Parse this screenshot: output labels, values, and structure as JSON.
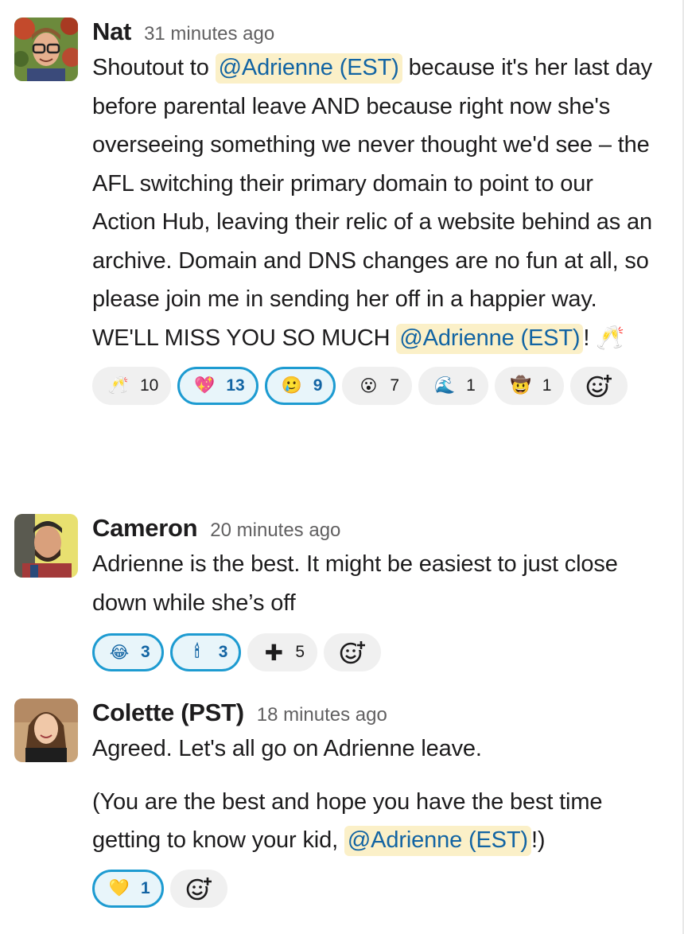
{
  "messages": [
    {
      "name": "Nat",
      "time": "31 minutes ago",
      "text_before_mention": "Shoutout to ",
      "mention_1": "@Adrienne (EST)",
      "text_after_mention": " because it's her last day before parental leave AND because right now she's overseeing something we never thought we'd see – the AFL switching their primary domain to point to our Action Hub, leaving their relic of a website behind as an archive. Domain and DNS changes are no fun at all, so please join me in sending her off in a happier way. WE'LL MISS YOU SO MUCH ",
      "mention_2": "@Adrienne (EST)",
      "text_end": "! ",
      "end_emoji": "🥂",
      "reactions": [
        {
          "icon": "clinking-glasses-icon",
          "emoji": "🥂",
          "count": "10",
          "active": false
        },
        {
          "icon": "gem-heart-icon",
          "emoji": "💖",
          "count": "13",
          "active": true
        },
        {
          "icon": "crying-face-icon",
          "emoji": "🥲",
          "count": "9",
          "active": true
        },
        {
          "icon": "astonished-face-icon",
          "emoji": "😮",
          "count": "7",
          "active": false
        },
        {
          "icon": "wave-icon",
          "emoji": "🌊",
          "count": "1",
          "active": false
        },
        {
          "icon": "cowboy-sunglasses-icon",
          "emoji": "🤠",
          "count": "1",
          "active": false
        }
      ]
    },
    {
      "name": "Cameron",
      "time": "20 minutes ago",
      "text": "Adrienne is the best. It might be easiest to just close down while she’s off",
      "reactions": [
        {
          "icon": "tears-of-joy-icon",
          "emoji": "😂",
          "count": "3",
          "active": true
        },
        {
          "icon": "candle-icon",
          "emoji": "🕯",
          "count": "3",
          "active": true
        },
        {
          "icon": "plus-icon",
          "emoji": "✚",
          "count": "5",
          "active": false
        }
      ]
    },
    {
      "name": "Colette (PST)",
      "time": "18 minutes ago",
      "para1": "Agreed. Let's all go on Adrienne leave.",
      "para2_before": "(You are the best and hope you have the best time getting to know your kid, ",
      "mention": "@Adrienne (EST)",
      "para2_after": "!)",
      "reactions": [
        {
          "icon": "yellow-heart-icon",
          "emoji": "💛",
          "count": "1",
          "active": true
        }
      ]
    }
  ],
  "add_reaction_icon": "add-reaction-icon"
}
